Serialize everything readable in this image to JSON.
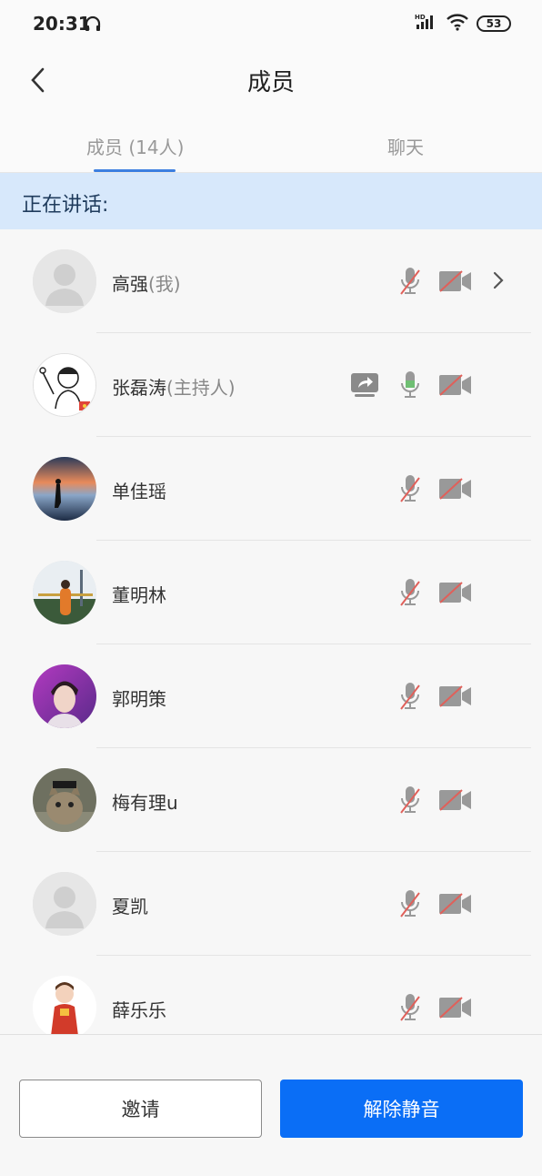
{
  "status_bar": {
    "time": "20:31",
    "network": "HD",
    "battery": "53"
  },
  "header": {
    "title": "成员"
  },
  "tabs": [
    {
      "label": "成员 (14人)",
      "active": true
    },
    {
      "label": "聊天",
      "active": false
    }
  ],
  "speaking_label": "正在讲话:",
  "members": [
    {
      "name": "高强",
      "suffix": "(我)",
      "avatar": "default-avatar",
      "mic": "muted",
      "camera": "off",
      "has_chevron": true,
      "sharing": false
    },
    {
      "name": "张磊涛",
      "suffix": "(主持人)",
      "avatar": "cartoon-avatar",
      "mic": "active",
      "camera": "off",
      "has_chevron": false,
      "sharing": true
    },
    {
      "name": "单佳瑶",
      "suffix": "",
      "avatar": "sunset-photo",
      "mic": "muted",
      "camera": "off",
      "has_chevron": false,
      "sharing": false
    },
    {
      "name": "董明林",
      "suffix": "",
      "avatar": "city-photo",
      "mic": "muted",
      "camera": "off",
      "has_chevron": false,
      "sharing": false
    },
    {
      "name": "郭明策",
      "suffix": "",
      "avatar": "portrait-photo",
      "mic": "muted",
      "camera": "off",
      "has_chevron": false,
      "sharing": false
    },
    {
      "name": "梅有理u",
      "suffix": "",
      "avatar": "cat-photo",
      "mic": "muted",
      "camera": "off",
      "has_chevron": false,
      "sharing": false
    },
    {
      "name": "夏凯",
      "suffix": "",
      "avatar": "default-avatar",
      "mic": "muted",
      "camera": "off",
      "has_chevron": false,
      "sharing": false
    },
    {
      "name": "薛乐乐",
      "suffix": "",
      "avatar": "girl-cartoon",
      "mic": "muted",
      "camera": "off",
      "has_chevron": false,
      "sharing": false
    }
  ],
  "buttons": {
    "invite": "邀请",
    "unmute": "解除静音"
  },
  "colors": {
    "primary": "#0a6ef6",
    "tab_indicator": "#3d7fe0",
    "speaking_bg": "#d7e8fb",
    "muted_slash": "#e0605a",
    "mic_active": "#6fbf73"
  }
}
